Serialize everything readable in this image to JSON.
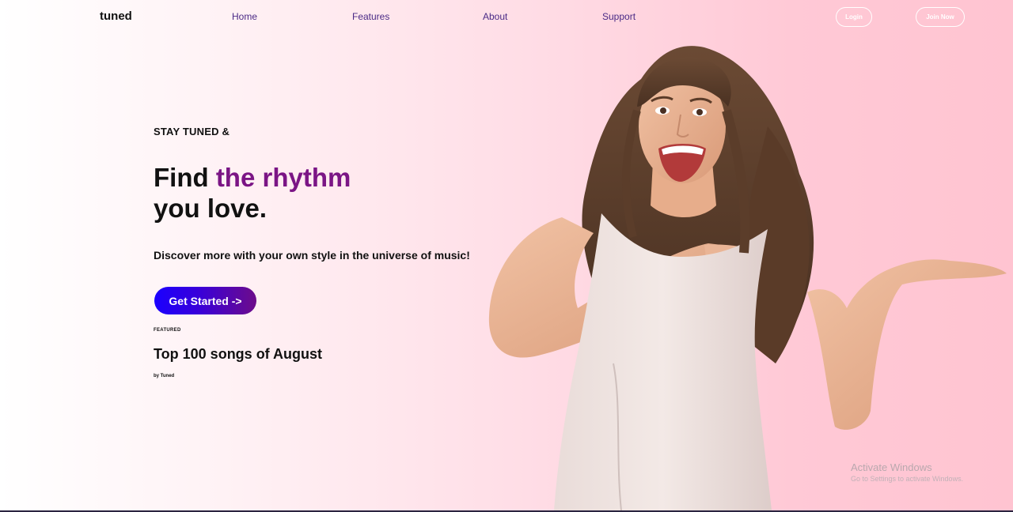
{
  "brand": "tuned",
  "nav": {
    "links": [
      "Home",
      "Features",
      "About",
      "Support"
    ],
    "login": "Login",
    "join": "Join Now"
  },
  "hero": {
    "eyebrow": "STAY TUNED &",
    "headline_plain": "Find ",
    "headline_accent": "the rhythm",
    "headline_line2": "you love.",
    "tagline": "Discover more with your own style in the universe of music!",
    "cta": "Get Started ->",
    "image": "woman-smiling-pointing-photo"
  },
  "featured": {
    "tag": "FEATURED",
    "title": "Top 100 songs of August",
    "byline": "by Tuned"
  },
  "watermark": {
    "title": "Activate Windows",
    "subtitle": "Go to Settings to activate Windows."
  },
  "colors": {
    "accent": "#7b1585",
    "nav_link": "#4a2a86",
    "cta_start": "#1a00ff",
    "cta_end": "#6d0c8a",
    "background_end": "#ffc4d1"
  }
}
